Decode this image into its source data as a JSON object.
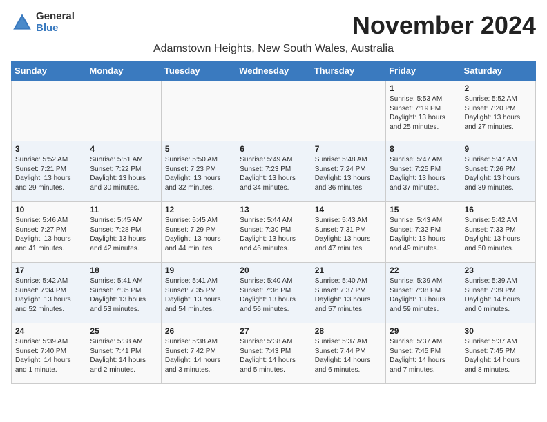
{
  "logo": {
    "general": "General",
    "blue": "Blue"
  },
  "title": "November 2024",
  "location": "Adamstown Heights, New South Wales, Australia",
  "days_of_week": [
    "Sunday",
    "Monday",
    "Tuesday",
    "Wednesday",
    "Thursday",
    "Friday",
    "Saturday"
  ],
  "weeks": [
    [
      {
        "day": "",
        "info": ""
      },
      {
        "day": "",
        "info": ""
      },
      {
        "day": "",
        "info": ""
      },
      {
        "day": "",
        "info": ""
      },
      {
        "day": "",
        "info": ""
      },
      {
        "day": "1",
        "info": "Sunrise: 5:53 AM\nSunset: 7:19 PM\nDaylight: 13 hours\nand 25 minutes."
      },
      {
        "day": "2",
        "info": "Sunrise: 5:52 AM\nSunset: 7:20 PM\nDaylight: 13 hours\nand 27 minutes."
      }
    ],
    [
      {
        "day": "3",
        "info": "Sunrise: 5:52 AM\nSunset: 7:21 PM\nDaylight: 13 hours\nand 29 minutes."
      },
      {
        "day": "4",
        "info": "Sunrise: 5:51 AM\nSunset: 7:22 PM\nDaylight: 13 hours\nand 30 minutes."
      },
      {
        "day": "5",
        "info": "Sunrise: 5:50 AM\nSunset: 7:23 PM\nDaylight: 13 hours\nand 32 minutes."
      },
      {
        "day": "6",
        "info": "Sunrise: 5:49 AM\nSunset: 7:23 PM\nDaylight: 13 hours\nand 34 minutes."
      },
      {
        "day": "7",
        "info": "Sunrise: 5:48 AM\nSunset: 7:24 PM\nDaylight: 13 hours\nand 36 minutes."
      },
      {
        "day": "8",
        "info": "Sunrise: 5:47 AM\nSunset: 7:25 PM\nDaylight: 13 hours\nand 37 minutes."
      },
      {
        "day": "9",
        "info": "Sunrise: 5:47 AM\nSunset: 7:26 PM\nDaylight: 13 hours\nand 39 minutes."
      }
    ],
    [
      {
        "day": "10",
        "info": "Sunrise: 5:46 AM\nSunset: 7:27 PM\nDaylight: 13 hours\nand 41 minutes."
      },
      {
        "day": "11",
        "info": "Sunrise: 5:45 AM\nSunset: 7:28 PM\nDaylight: 13 hours\nand 42 minutes."
      },
      {
        "day": "12",
        "info": "Sunrise: 5:45 AM\nSunset: 7:29 PM\nDaylight: 13 hours\nand 44 minutes."
      },
      {
        "day": "13",
        "info": "Sunrise: 5:44 AM\nSunset: 7:30 PM\nDaylight: 13 hours\nand 46 minutes."
      },
      {
        "day": "14",
        "info": "Sunrise: 5:43 AM\nSunset: 7:31 PM\nDaylight: 13 hours\nand 47 minutes."
      },
      {
        "day": "15",
        "info": "Sunrise: 5:43 AM\nSunset: 7:32 PM\nDaylight: 13 hours\nand 49 minutes."
      },
      {
        "day": "16",
        "info": "Sunrise: 5:42 AM\nSunset: 7:33 PM\nDaylight: 13 hours\nand 50 minutes."
      }
    ],
    [
      {
        "day": "17",
        "info": "Sunrise: 5:42 AM\nSunset: 7:34 PM\nDaylight: 13 hours\nand 52 minutes."
      },
      {
        "day": "18",
        "info": "Sunrise: 5:41 AM\nSunset: 7:35 PM\nDaylight: 13 hours\nand 53 minutes."
      },
      {
        "day": "19",
        "info": "Sunrise: 5:41 AM\nSunset: 7:35 PM\nDaylight: 13 hours\nand 54 minutes."
      },
      {
        "day": "20",
        "info": "Sunrise: 5:40 AM\nSunset: 7:36 PM\nDaylight: 13 hours\nand 56 minutes."
      },
      {
        "day": "21",
        "info": "Sunrise: 5:40 AM\nSunset: 7:37 PM\nDaylight: 13 hours\nand 57 minutes."
      },
      {
        "day": "22",
        "info": "Sunrise: 5:39 AM\nSunset: 7:38 PM\nDaylight: 13 hours\nand 59 minutes."
      },
      {
        "day": "23",
        "info": "Sunrise: 5:39 AM\nSunset: 7:39 PM\nDaylight: 14 hours\nand 0 minutes."
      }
    ],
    [
      {
        "day": "24",
        "info": "Sunrise: 5:39 AM\nSunset: 7:40 PM\nDaylight: 14 hours\nand 1 minute."
      },
      {
        "day": "25",
        "info": "Sunrise: 5:38 AM\nSunset: 7:41 PM\nDaylight: 14 hours\nand 2 minutes."
      },
      {
        "day": "26",
        "info": "Sunrise: 5:38 AM\nSunset: 7:42 PM\nDaylight: 14 hours\nand 3 minutes."
      },
      {
        "day": "27",
        "info": "Sunrise: 5:38 AM\nSunset: 7:43 PM\nDaylight: 14 hours\nand 5 minutes."
      },
      {
        "day": "28",
        "info": "Sunrise: 5:37 AM\nSunset: 7:44 PM\nDaylight: 14 hours\nand 6 minutes."
      },
      {
        "day": "29",
        "info": "Sunrise: 5:37 AM\nSunset: 7:45 PM\nDaylight: 14 hours\nand 7 minutes."
      },
      {
        "day": "30",
        "info": "Sunrise: 5:37 AM\nSunset: 7:45 PM\nDaylight: 14 hours\nand 8 minutes."
      }
    ]
  ]
}
